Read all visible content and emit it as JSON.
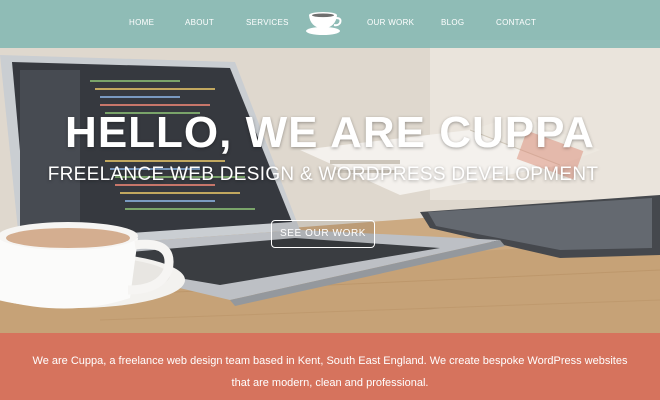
{
  "nav": {
    "items": [
      "HOME",
      "ABOUT",
      "SERVICES",
      "OUR WORK",
      "BLOG",
      "CONTACT"
    ],
    "logo_icon": "coffee-cup-icon"
  },
  "hero": {
    "title": "HELLO, WE ARE CUPPA",
    "subtitle": "FREELANCE WEB DESIGN & WORDPRESS DEVELOPMENT",
    "cta_label": "SEE OUR WORK"
  },
  "intro": {
    "text": "We are Cuppa, a freelance web design team based in Kent, South East England. We create bespoke WordPress websites that are modern, clean and professional."
  },
  "colors": {
    "nav_bg": "#78b4b0",
    "intro_bg": "#d6735d",
    "text": "#ffffff"
  }
}
